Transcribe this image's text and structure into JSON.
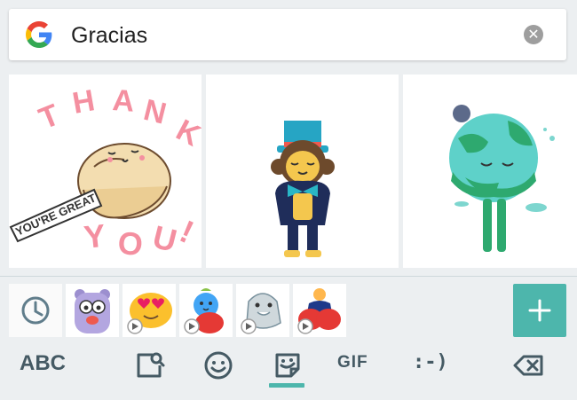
{
  "search": {
    "query": "Gracias",
    "logo_icon": "google-g-icon",
    "clear_icon": "clear-icon"
  },
  "results": [
    {
      "sticker": "thank-you-fortune-cookie",
      "lines": [
        "THANK",
        "YOU'RE GREAT",
        "YOU!"
      ]
    },
    {
      "sticker": "monkey-top-hat-bow"
    },
    {
      "sticker": "earth-globe-bow"
    }
  ],
  "strip": {
    "recent_icon": "clock-icon",
    "packs": [
      {
        "name": "purple-bear-sticker",
        "animated": false
      },
      {
        "name": "heart-eyes-blob-sticker",
        "animated": true
      },
      {
        "name": "blue-bird-sticker",
        "animated": true
      },
      {
        "name": "shark-sticker",
        "animated": true
      },
      {
        "name": "hug-people-sticker",
        "animated": true
      }
    ],
    "add_icon": "plus-icon"
  },
  "bottom_bar": {
    "abc_label": "ABC",
    "gif_label": "GIF",
    "emoticon_label": ":-)",
    "active_tab": "stickers"
  },
  "colors": {
    "accent": "#4db6ac",
    "key_text": "#455a64",
    "background": "#eceff1"
  }
}
